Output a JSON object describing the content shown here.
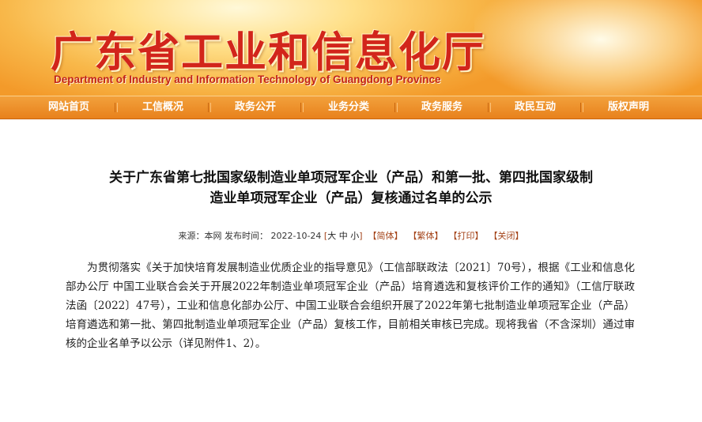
{
  "header": {
    "site_title": "广东省工业和信息化厅",
    "site_subtitle": "Department of Industry and Information Technology of Guangdong Province"
  },
  "nav": {
    "items": [
      {
        "label": "网站首页"
      },
      {
        "label": "工信概况"
      },
      {
        "label": "政务公开"
      },
      {
        "label": "业务分类"
      },
      {
        "label": "政务服务"
      },
      {
        "label": "政民互动"
      },
      {
        "label": "版权声明"
      }
    ]
  },
  "article": {
    "title_line1": "关于广东省第七批国家级制造业单项冠军企业（产品）和第一批、第四批国家级制",
    "title_line2": "造业单项冠军企业（产品）复核通过名单的公示",
    "meta": {
      "source_label": "来源：本网",
      "publish_label": "发布时间：",
      "publish_time": "2022-10-24",
      "font_big": "大",
      "font_mid": "中",
      "font_small": "小",
      "simplified": "【简体】",
      "traditional": "【繁体】",
      "print": "【打印】",
      "close": "【关闭】"
    },
    "body": "为贯彻落实《关于加快培育发展制造业优质企业的指导意见》（工信部联政法〔2021〕70号），根据《工业和信息化部办公厅 中国工业联合会关于开展2022年制造业单项冠军企业（产品）培育遴选和复核评价工作的通知》（工信厅联政法函〔2022〕47号），工业和信息化部办公厅、中国工业联合会组织开展了2022年第七批制造业单项冠军企业（产品）培育遴选和第一批、第四批制造业单项冠军企业（产品）复核工作，目前相关审核已完成。现将我省（不含深圳）通过审核的企业名单予以公示（详见附件1、2）。"
  },
  "colors": {
    "title_red": "#d2251b",
    "nav_orange": "#e8811c",
    "link_brown": "#a4441a"
  }
}
